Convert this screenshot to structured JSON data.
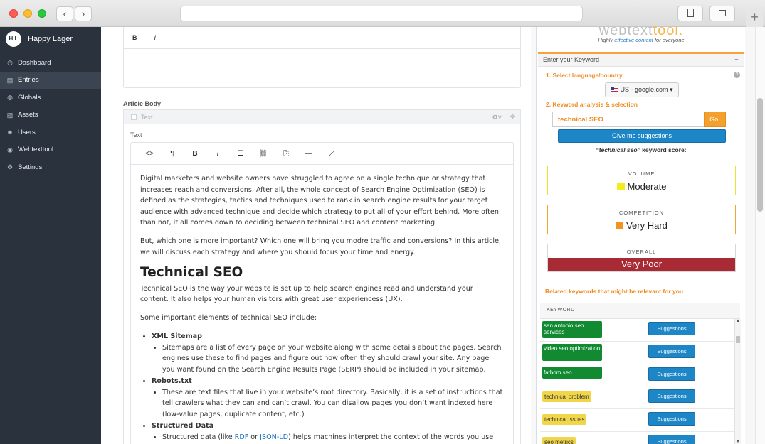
{
  "sidebar": {
    "brand": {
      "logo_text": "H.L",
      "name": "Happy Lager"
    },
    "items": [
      {
        "icon": "dashboard-icon",
        "glyph": "◷",
        "label": "Dashboard"
      },
      {
        "icon": "entries-icon",
        "glyph": "▤",
        "label": "Entries"
      },
      {
        "icon": "globals-icon",
        "glyph": "◍",
        "label": "Globals"
      },
      {
        "icon": "assets-icon",
        "glyph": "▨",
        "label": "Assets"
      },
      {
        "icon": "users-icon",
        "glyph": "☻",
        "label": "Users"
      },
      {
        "icon": "webtexttool-icon",
        "glyph": "◉",
        "label": "Webtexttool"
      },
      {
        "icon": "settings-icon",
        "glyph": "⚙",
        "label": "Settings"
      }
    ],
    "active": "Entries"
  },
  "editor_top": {
    "bold": "B",
    "italic": "I"
  },
  "field": {
    "label": "Article Body",
    "block_type": "Text",
    "text_label": "Text"
  },
  "toolbar": {
    "code": "<>",
    "paragraph": "¶",
    "bold": "B",
    "italic": "I",
    "list": "☰",
    "link": "⛓",
    "embed": "⎘",
    "hr": "—",
    "fullscreen": "⤢"
  },
  "article": {
    "p1": "Digital marketers and website owners have struggled to agree on a single technique or strategy that increases reach and conversions. After all, the whole concept of Search Engine Optimization (SEO) is defined as the strategies, tactics and techniques used to rank in search engine results for your target audience with advanced technique and decide which strategy to put all of your effort behind. More often than not, it all comes down to deciding between technical SEO and content marketing.",
    "p2": "But, which one is more important? Which one will bring you modre traffic and conversions? In this article, we will discuss each strategy and where you should focus your time and energy.",
    "h2": "Technical SEO",
    "p3": "Technical SEO is the way your website is set up to help search engines read and understand your content. It also helps your human visitors with great user experiencess (UX).",
    "p4": "Some important elements of technical SEO include:",
    "items": [
      {
        "title": "XML Sitemap",
        "text": "Sitemaps are a list of every page on your website along with some details about the pages. Search engines use these to find pages and figure out how often they should crawl your site. Any page you want found on the Search Engine Results Page (SERP) should be included in your sitemap."
      },
      {
        "title": "Robots.txt",
        "text": "These are text files that live in your website’s root directory. Basically, it is a set of instructions that tell crawlers what they can and can’t crawl. You can disallow pages you don’t want indexed here (low-value pages, duplicate content, etc.)"
      },
      {
        "title": "Structured Data"
      }
    ],
    "last_line_pre": "Structured data (like ",
    "link1": "RDF",
    "last_line_mid": " or ",
    "link2": "JSON-LD",
    "last_line_post": ") helps machines interpret the context of the words you use"
  },
  "wtt": {
    "logo_a": "webtext",
    "logo_b": "tool.",
    "tagline_a": "Highly ",
    "tagline_b": "effective content",
    "tagline_c": " for everyone",
    "panel_title": "Enter your Keyword",
    "step1": "1. Select language/country",
    "lang": "US - google.com",
    "step2": "2. Keyword analysis & selection",
    "keyword": "technical SEO",
    "go": "Go!",
    "suggest": "Give me suggestions",
    "score_kw": "“technical seo”",
    "score_suffix": " keyword score:",
    "volume_label": "VOLUME",
    "volume_value": "Moderate",
    "volume_color": "#f2ec1b",
    "competition_label": "COMPETITION",
    "competition_value": "Very Hard",
    "competition_color": "#f29422",
    "overall_label": "OVERALL",
    "overall_value": "Very Poor",
    "related_title": "Related keywords that might be relevant for you",
    "col_keyword": "KEYWORD",
    "related": [
      {
        "kw": "san antonio seo services",
        "style": "green",
        "btn": "Suggestions"
      },
      {
        "kw": "video seo optimization",
        "style": "green",
        "btn": "Suggestions"
      },
      {
        "kw": "fathom seo",
        "style": "green single",
        "btn": "Suggestions"
      },
      {
        "kw": "technical problem",
        "style": "yellow",
        "btn": "Suggestions"
      },
      {
        "kw": "technical issues",
        "style": "yellow",
        "btn": "Suggestions"
      },
      {
        "kw": "seo metrics",
        "style": "yellow",
        "btn": "Suggestions"
      }
    ]
  }
}
